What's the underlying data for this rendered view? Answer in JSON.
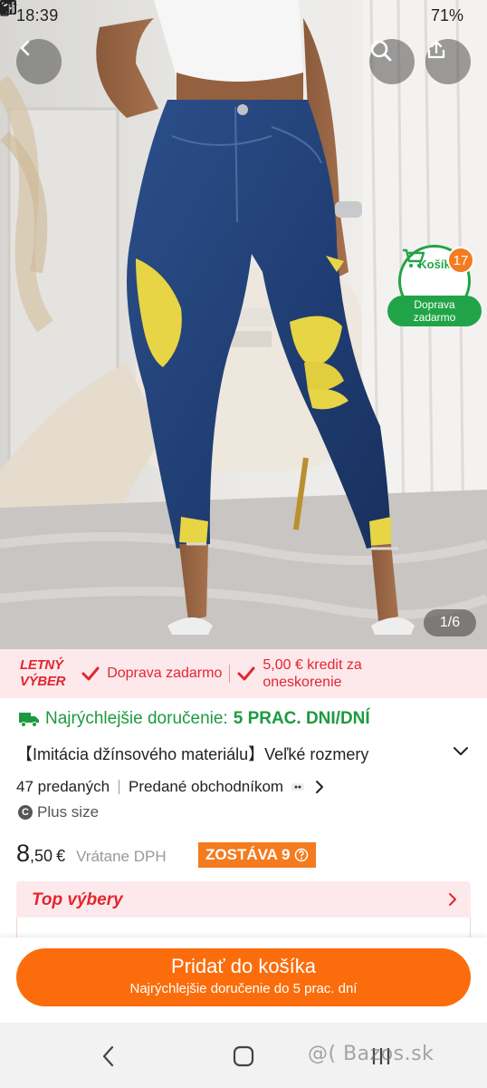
{
  "status_bar": {
    "time": "18:39",
    "battery": "71%"
  },
  "product_image": {
    "pager": "1/6"
  },
  "cart": {
    "label": "Košík",
    "count": "17",
    "shipping_line1": "Doprava",
    "shipping_line2": "zadarmo"
  },
  "promo": {
    "logo_line1": "LETNÝ",
    "logo_line2": "VÝBER",
    "item1": "Doprava zadarmo",
    "item2_line1": "5,00 € kredit za",
    "item2_line2": "oneskorenie"
  },
  "delivery": {
    "label": "Najrýchlejšie doručenie:",
    "value": "5 PRAC. DNI/DNÍ"
  },
  "product": {
    "title": "【Imitácia džínsového materiálu】Veľké rozmery",
    "sold": "47 predaných",
    "sold_by": "Predané obchodníkom",
    "category": "Plus size",
    "price_int": "8",
    "price_dec": ",50",
    "currency": "€",
    "vat_note": "Vrátane DPH",
    "stock": "ZOSTÁVA 9"
  },
  "top_picks": {
    "title": "Top výbery"
  },
  "cta": {
    "main": "Pridať do košíka",
    "sub": "Najrýchlejšie doručenie do 5 prac. dní"
  },
  "watermark": "@( Bazos.sk",
  "colors": {
    "brand_orange": "#fb6d0c",
    "promo_red": "#e3262f",
    "green": "#21a447"
  }
}
